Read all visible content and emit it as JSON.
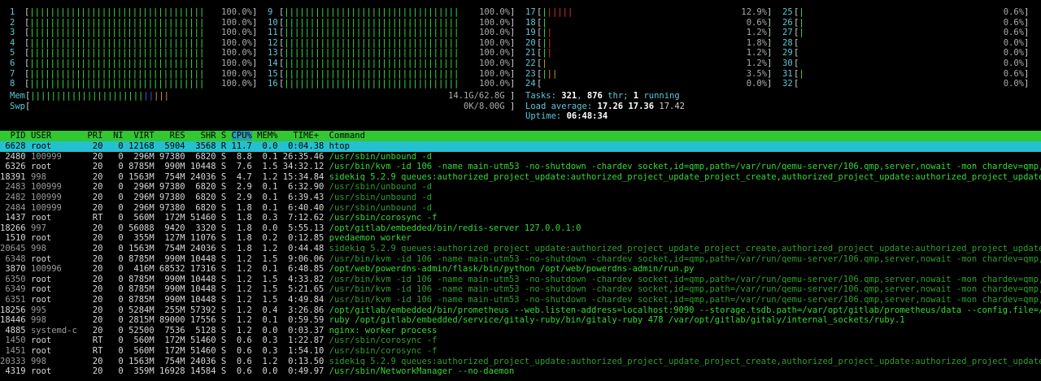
{
  "meters_col1": [
    {
      "num": "1",
      "bar": "||||||||||||||||||||||||||||||||||",
      "pct": "100.0%"
    },
    {
      "num": "2",
      "bar": "||||||||||||||||||||||||||||||||||",
      "pct": "100.0%"
    },
    {
      "num": "3",
      "bar": "||||||||||||||||||||||||||||||||||",
      "pct": "100.0%"
    },
    {
      "num": "4",
      "bar": "||||||||||||||||||||||||||||||||||",
      "pct": "100.0%"
    },
    {
      "num": "5",
      "bar": "||||||||||||||||||||||||||||||||||",
      "pct": "100.0%"
    },
    {
      "num": "6",
      "bar": "||||||||||||||||||||||||||||||||||",
      "pct": "100.0%"
    },
    {
      "num": "7",
      "bar": "||||||||||||||||||||||||||||||||||",
      "pct": "100.0%"
    },
    {
      "num": "8",
      "bar": "||||||||||||||||||||||||||||||||||",
      "pct": "100.0%"
    }
  ],
  "meters_col2": [
    {
      "num": "9",
      "bar": "||||||||||||||||||||||||||||||||||",
      "pct": "100.0%"
    },
    {
      "num": "10",
      "bar": "||||||||||||||||||||||||||||||||||",
      "pct": "100.0%"
    },
    {
      "num": "11",
      "bar": "||||||||||||||||||||||||||||||||||",
      "pct": "100.0%"
    },
    {
      "num": "12",
      "bar": "||||||||||||||||||||||||||||||||||",
      "pct": "100.0%"
    },
    {
      "num": "13",
      "bar": "||||||||||||||||||||||||||||||||||",
      "pct": "100.0%"
    },
    {
      "num": "14",
      "bar": "||||||||||||||||||||||||||||||||||",
      "pct": "100.0%"
    },
    {
      "num": "15",
      "bar": "||||||||||||||||||||||||||||||||||",
      "pct": "100.0%"
    },
    {
      "num": "16",
      "bar": "||||||||||||||||||||||||||||||||||",
      "pct": "100.0%"
    }
  ],
  "meters_col3": [
    {
      "num": "17",
      "bar": "||||||",
      "pct": "12.9%"
    },
    {
      "num": "18",
      "bar": "|",
      "pct": "0.6%"
    },
    {
      "num": "19",
      "bar": "||",
      "pct": "1.2%"
    },
    {
      "num": "20",
      "bar": "||",
      "pct": "1.8%"
    },
    {
      "num": "21",
      "bar": "||",
      "pct": "1.2%"
    },
    {
      "num": "22",
      "bar": "|",
      "pct": "1.2%"
    },
    {
      "num": "23",
      "bar": "|||",
      "pct": "3.5%"
    },
    {
      "num": "24",
      "bar": "",
      "pct": "0.0%"
    }
  ],
  "meters_col4": [
    {
      "num": "25",
      "bar": "|",
      "pct": "0.6%"
    },
    {
      "num": "26",
      "bar": "|",
      "pct": "0.6%"
    },
    {
      "num": "27",
      "bar": "|",
      "pct": "0.6%"
    },
    {
      "num": "28",
      "bar": "",
      "pct": "0.0%"
    },
    {
      "num": "29",
      "bar": "",
      "pct": "0.0%"
    },
    {
      "num": "30",
      "bar": "",
      "pct": "0.0%"
    },
    {
      "num": "31",
      "bar": "|",
      "pct": "0.6%"
    },
    {
      "num": "32",
      "bar": "",
      "pct": "0.0%"
    }
  ],
  "mem": {
    "label": "Mem",
    "bar_green": "||||||||||||||||||||||",
    "bar_blue": "||",
    "bar_orange": "|||",
    "value": "14.1G/62.8G"
  },
  "swp": {
    "label": "Swp",
    "value": "0K/8.00G"
  },
  "tasks": {
    "label": "Tasks: ",
    "count": "321",
    "sep": ", ",
    "threads": "876",
    "thr": " thr; ",
    "running": "1",
    "running_label": " running"
  },
  "load": {
    "label": "Load average: ",
    "l1": "17.26",
    "l5": "17.36",
    "l15": "17.42"
  },
  "uptime": {
    "label": "Uptime: ",
    "value": "06:48:34"
  },
  "header": {
    "pid": "  PID",
    "user": "USER     ",
    "pri": "  PRI",
    "ni": "  NI",
    "virt": "  VIRT",
    "res": "   RES",
    "shr": "   SHR",
    "s": " S",
    "cpu": "CPU%",
    "mem": " MEM%",
    "time": "   TIME+",
    "cmd": "  Command"
  },
  "processes": [
    {
      "pid": "6628",
      "user": "root",
      "pri": "20",
      "ni": "0",
      "virt": "12168",
      "res": "5904",
      "shr": "3568",
      "s": "R",
      "cpu": "11.7",
      "mem": "0.0",
      "time": "0:04.38",
      "cmd": "htop",
      "sel": true
    },
    {
      "pid": "2480",
      "user": "100999",
      "pri": "20",
      "ni": "0",
      "virt": "296M",
      "res": "97380",
      "shr": "6820",
      "s": "S",
      "cpu": "8.8",
      "mem": "0.1",
      "time": "26:35.46",
      "cmd": "/usr/sbin/unbound -d"
    },
    {
      "pid": "6326",
      "user": "root",
      "pri": "20",
      "ni": "0",
      "virt": "8785M",
      "res": "990M",
      "shr": "10448",
      "s": "S",
      "cpu": "7.6",
      "mem": "1.5",
      "time": "34:32.12",
      "cmd": "/usr/bin/kvm -id 106 -name main-utm53 -no-shutdown -chardev socket,id=qmp,path=/var/run/qemu-server/106.qmp,server,nowait -mon chardev=qmp,m"
    },
    {
      "pid": "18391",
      "user": "998",
      "pri": "20",
      "ni": "0",
      "virt": "1563M",
      "res": "754M",
      "shr": "24036",
      "s": "S",
      "cpu": "4.7",
      "mem": "1.2",
      "time": "15:34.84",
      "cmd": "sidekiq 5.2.9 queues:authorized_project_update:authorized_project_update_project_create,authorized_project_update:authorized_project_update"
    },
    {
      "pid": "2483",
      "user": "100999",
      "pri": "20",
      "ni": "0",
      "virt": "296M",
      "res": "97380",
      "shr": "6820",
      "s": "S",
      "cpu": "2.9",
      "mem": "0.1",
      "time": "6:32.90",
      "cmd": "/usr/sbin/unbound -d",
      "dim": true
    },
    {
      "pid": "2482",
      "user": "100999",
      "pri": "20",
      "ni": "0",
      "virt": "296M",
      "res": "97380",
      "shr": "6820",
      "s": "S",
      "cpu": "2.9",
      "mem": "0.1",
      "time": "6:39.43",
      "cmd": "/usr/sbin/unbound -d",
      "dim": true
    },
    {
      "pid": "2484",
      "user": "100999",
      "pri": "20",
      "ni": "0",
      "virt": "296M",
      "res": "97380",
      "shr": "6820",
      "s": "S",
      "cpu": "1.8",
      "mem": "0.1",
      "time": "6:40.40",
      "cmd": "/usr/sbin/unbound -d",
      "dim": true
    },
    {
      "pid": "1437",
      "user": "root",
      "pri": "RT",
      "ni": "0",
      "virt": "560M",
      "res": "172M",
      "shr": "51460",
      "s": "S",
      "cpu": "1.8",
      "mem": "0.3",
      "time": "7:12.62",
      "cmd": "/usr/sbin/corosync -f"
    },
    {
      "pid": "18266",
      "user": "997",
      "pri": "20",
      "ni": "0",
      "virt": "56088",
      "res": "9420",
      "shr": "3320",
      "s": "S",
      "cpu": "1.8",
      "mem": "0.0",
      "time": "5:55.13",
      "cmd": "/opt/gitlab/embedded/bin/redis-server 127.0.0.1:0"
    },
    {
      "pid": "1510",
      "user": "root",
      "pri": "20",
      "ni": "0",
      "virt": "355M",
      "res": "127M",
      "shr": "11076",
      "s": "S",
      "cpu": "1.8",
      "mem": "0.2",
      "time": "0:12.85",
      "cmd": "pvedaemon worker"
    },
    {
      "pid": "20645",
      "user": "998",
      "pri": "20",
      "ni": "0",
      "virt": "1563M",
      "res": "754M",
      "shr": "24036",
      "s": "S",
      "cpu": "1.8",
      "mem": "1.2",
      "time": "0:44.48",
      "cmd": "sidekiq 5.2.9 queues:authorized_project_update:authorized_project_update_project_create,authorized_project_update:authorized_project_update",
      "dim": true
    },
    {
      "pid": "6348",
      "user": "root",
      "pri": "20",
      "ni": "0",
      "virt": "8785M",
      "res": "990M",
      "shr": "10448",
      "s": "S",
      "cpu": "1.2",
      "mem": "1.5",
      "time": "9:06.06",
      "cmd": "/usr/bin/kvm -id 106 -name main-utm53 -no-shutdown -chardev socket,id=qmp,path=/var/run/qemu-server/106.qmp,server,nowait -mon chardev=qmp,m",
      "dim": true
    },
    {
      "pid": "3870",
      "user": "100996",
      "pri": "20",
      "ni": "0",
      "virt": "416M",
      "res": "68532",
      "shr": "17316",
      "s": "S",
      "cpu": "1.2",
      "mem": "0.1",
      "time": "6:48.85",
      "cmd": "/opt/web/powerdns-admin/flask/bin/python /opt/web/powerdns-admin/run.py"
    },
    {
      "pid": "6350",
      "user": "root",
      "pri": "20",
      "ni": "0",
      "virt": "8785M",
      "res": "990M",
      "shr": "10448",
      "s": "S",
      "cpu": "1.2",
      "mem": "1.5",
      "time": "4:33.82",
      "cmd": "/usr/bin/kvm -id 106 -name main-utm53 -no-shutdown -chardev socket,id=qmp,path=/var/run/qemu-server/106.qmp,server,nowait -mon chardev=qmp,m",
      "dim": true
    },
    {
      "pid": "6349",
      "user": "root",
      "pri": "20",
      "ni": "0",
      "virt": "8785M",
      "res": "990M",
      "shr": "10448",
      "s": "S",
      "cpu": "1.2",
      "mem": "1.5",
      "time": "5:21.65",
      "cmd": "/usr/bin/kvm -id 106 -name main-utm53 -no-shutdown -chardev socket,id=qmp,path=/var/run/qemu-server/106.qmp,server,nowait -mon chardev=qmp,m",
      "dim": true
    },
    {
      "pid": "6351",
      "user": "root",
      "pri": "20",
      "ni": "0",
      "virt": "8785M",
      "res": "990M",
      "shr": "10448",
      "s": "S",
      "cpu": "1.2",
      "mem": "1.5",
      "time": "4:49.84",
      "cmd": "/usr/bin/kvm -id 106 -name main-utm53 -no-shutdown -chardev socket,id=qmp,path=/var/run/qemu-server/106.qmp,server,nowait -mon chardev=qmp,m",
      "dim": true
    },
    {
      "pid": "18256",
      "user": "995",
      "pri": "20",
      "ni": "0",
      "virt": "5284M",
      "res": "255M",
      "shr": "57392",
      "s": "S",
      "cpu": "1.2",
      "mem": "0.4",
      "time": "3:26.86",
      "cmd": "/opt/gitlab/embedded/bin/prometheus --web.listen-address=localhost:9090 --storage.tsdb.path=/var/opt/gitlab/prometheus/data --config.file=/v"
    },
    {
      "pid": "18446",
      "user": "998",
      "pri": "20",
      "ni": "0",
      "virt": "2815M",
      "res": "89000",
      "shr": "17556",
      "s": "S",
      "cpu": "1.2",
      "mem": "0.1",
      "time": "0:59.59",
      "cmd": "ruby /opt/gitlab/embedded/service/gitaly-ruby/bin/gitaly-ruby 478 /var/opt/gitlab/gitaly/internal_sockets/ruby.1"
    },
    {
      "pid": "4885",
      "user": "systemd-c",
      "pri": "20",
      "ni": "0",
      "virt": "52500",
      "res": "7536",
      "shr": "5128",
      "s": "S",
      "cpu": "1.2",
      "mem": "0.0",
      "time": "0:03.37",
      "cmd": "nginx: worker process"
    },
    {
      "pid": "1450",
      "user": "root",
      "pri": "RT",
      "ni": "0",
      "virt": "560M",
      "res": "172M",
      "shr": "51460",
      "s": "S",
      "cpu": "0.6",
      "mem": "0.3",
      "time": "1:22.87",
      "cmd": "/usr/sbin/corosync -f",
      "dim": true
    },
    {
      "pid": "1451",
      "user": "root",
      "pri": "RT",
      "ni": "0",
      "virt": "560M",
      "res": "172M",
      "shr": "51460",
      "s": "S",
      "cpu": "0.6",
      "mem": "0.3",
      "time": "1:54.10",
      "cmd": "/usr/sbin/corosync -f",
      "dim": true
    },
    {
      "pid": "20333",
      "user": "998",
      "pri": "20",
      "ni": "0",
      "virt": "1563M",
      "res": "754M",
      "shr": "24036",
      "s": "S",
      "cpu": "0.6",
      "mem": "1.2",
      "time": "0:13.50",
      "cmd": "sidekiq 5.2.9 queues:authorized_project_update:authorized_project_update_project_create,authorized_project_update:authorized_project_update",
      "dim": true
    },
    {
      "pid": "4319",
      "user": "root",
      "pri": "20",
      "ni": "0",
      "virt": "359M",
      "res": "16928",
      "shr": "14584",
      "s": "S",
      "cpu": "0.6",
      "mem": "0.0",
      "time": "0:49.97",
      "cmd": "/usr/sbin/NetworkManager --no-daemon"
    }
  ]
}
